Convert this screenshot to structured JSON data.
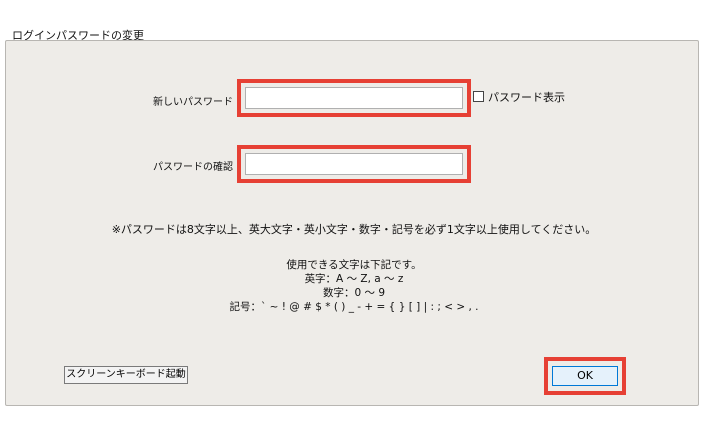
{
  "window": {
    "title": "ログインパスワードの変更"
  },
  "new_password": {
    "label": "新しいパスワード",
    "value": "",
    "show_password_label": "パスワード表示",
    "show_password_checked": false
  },
  "confirm_password": {
    "label": "パスワードの確認",
    "value": ""
  },
  "note": "※パスワードは8文字以上、英大文字・英小文字・数字・記号を必ず1文字以上使用してください。",
  "allowed_chars": {
    "heading": "使用できる文字は下記です。",
    "letters": "英字：A ～ Z, a ～ z",
    "digits": "数字：0 ～ 9",
    "symbols": "記号：` ~ ! @ # $ * ( ) _ - + = { } [ ] | : ; < > , ."
  },
  "buttons": {
    "screen_keyboard": "スクリーンキーボード起動",
    "ok": "OK"
  },
  "colors": {
    "highlight": "#e64034",
    "dialog_bg": "#eeece8",
    "ok_button_bg": "#e5f1fb",
    "ok_button_border": "#0078d7"
  }
}
